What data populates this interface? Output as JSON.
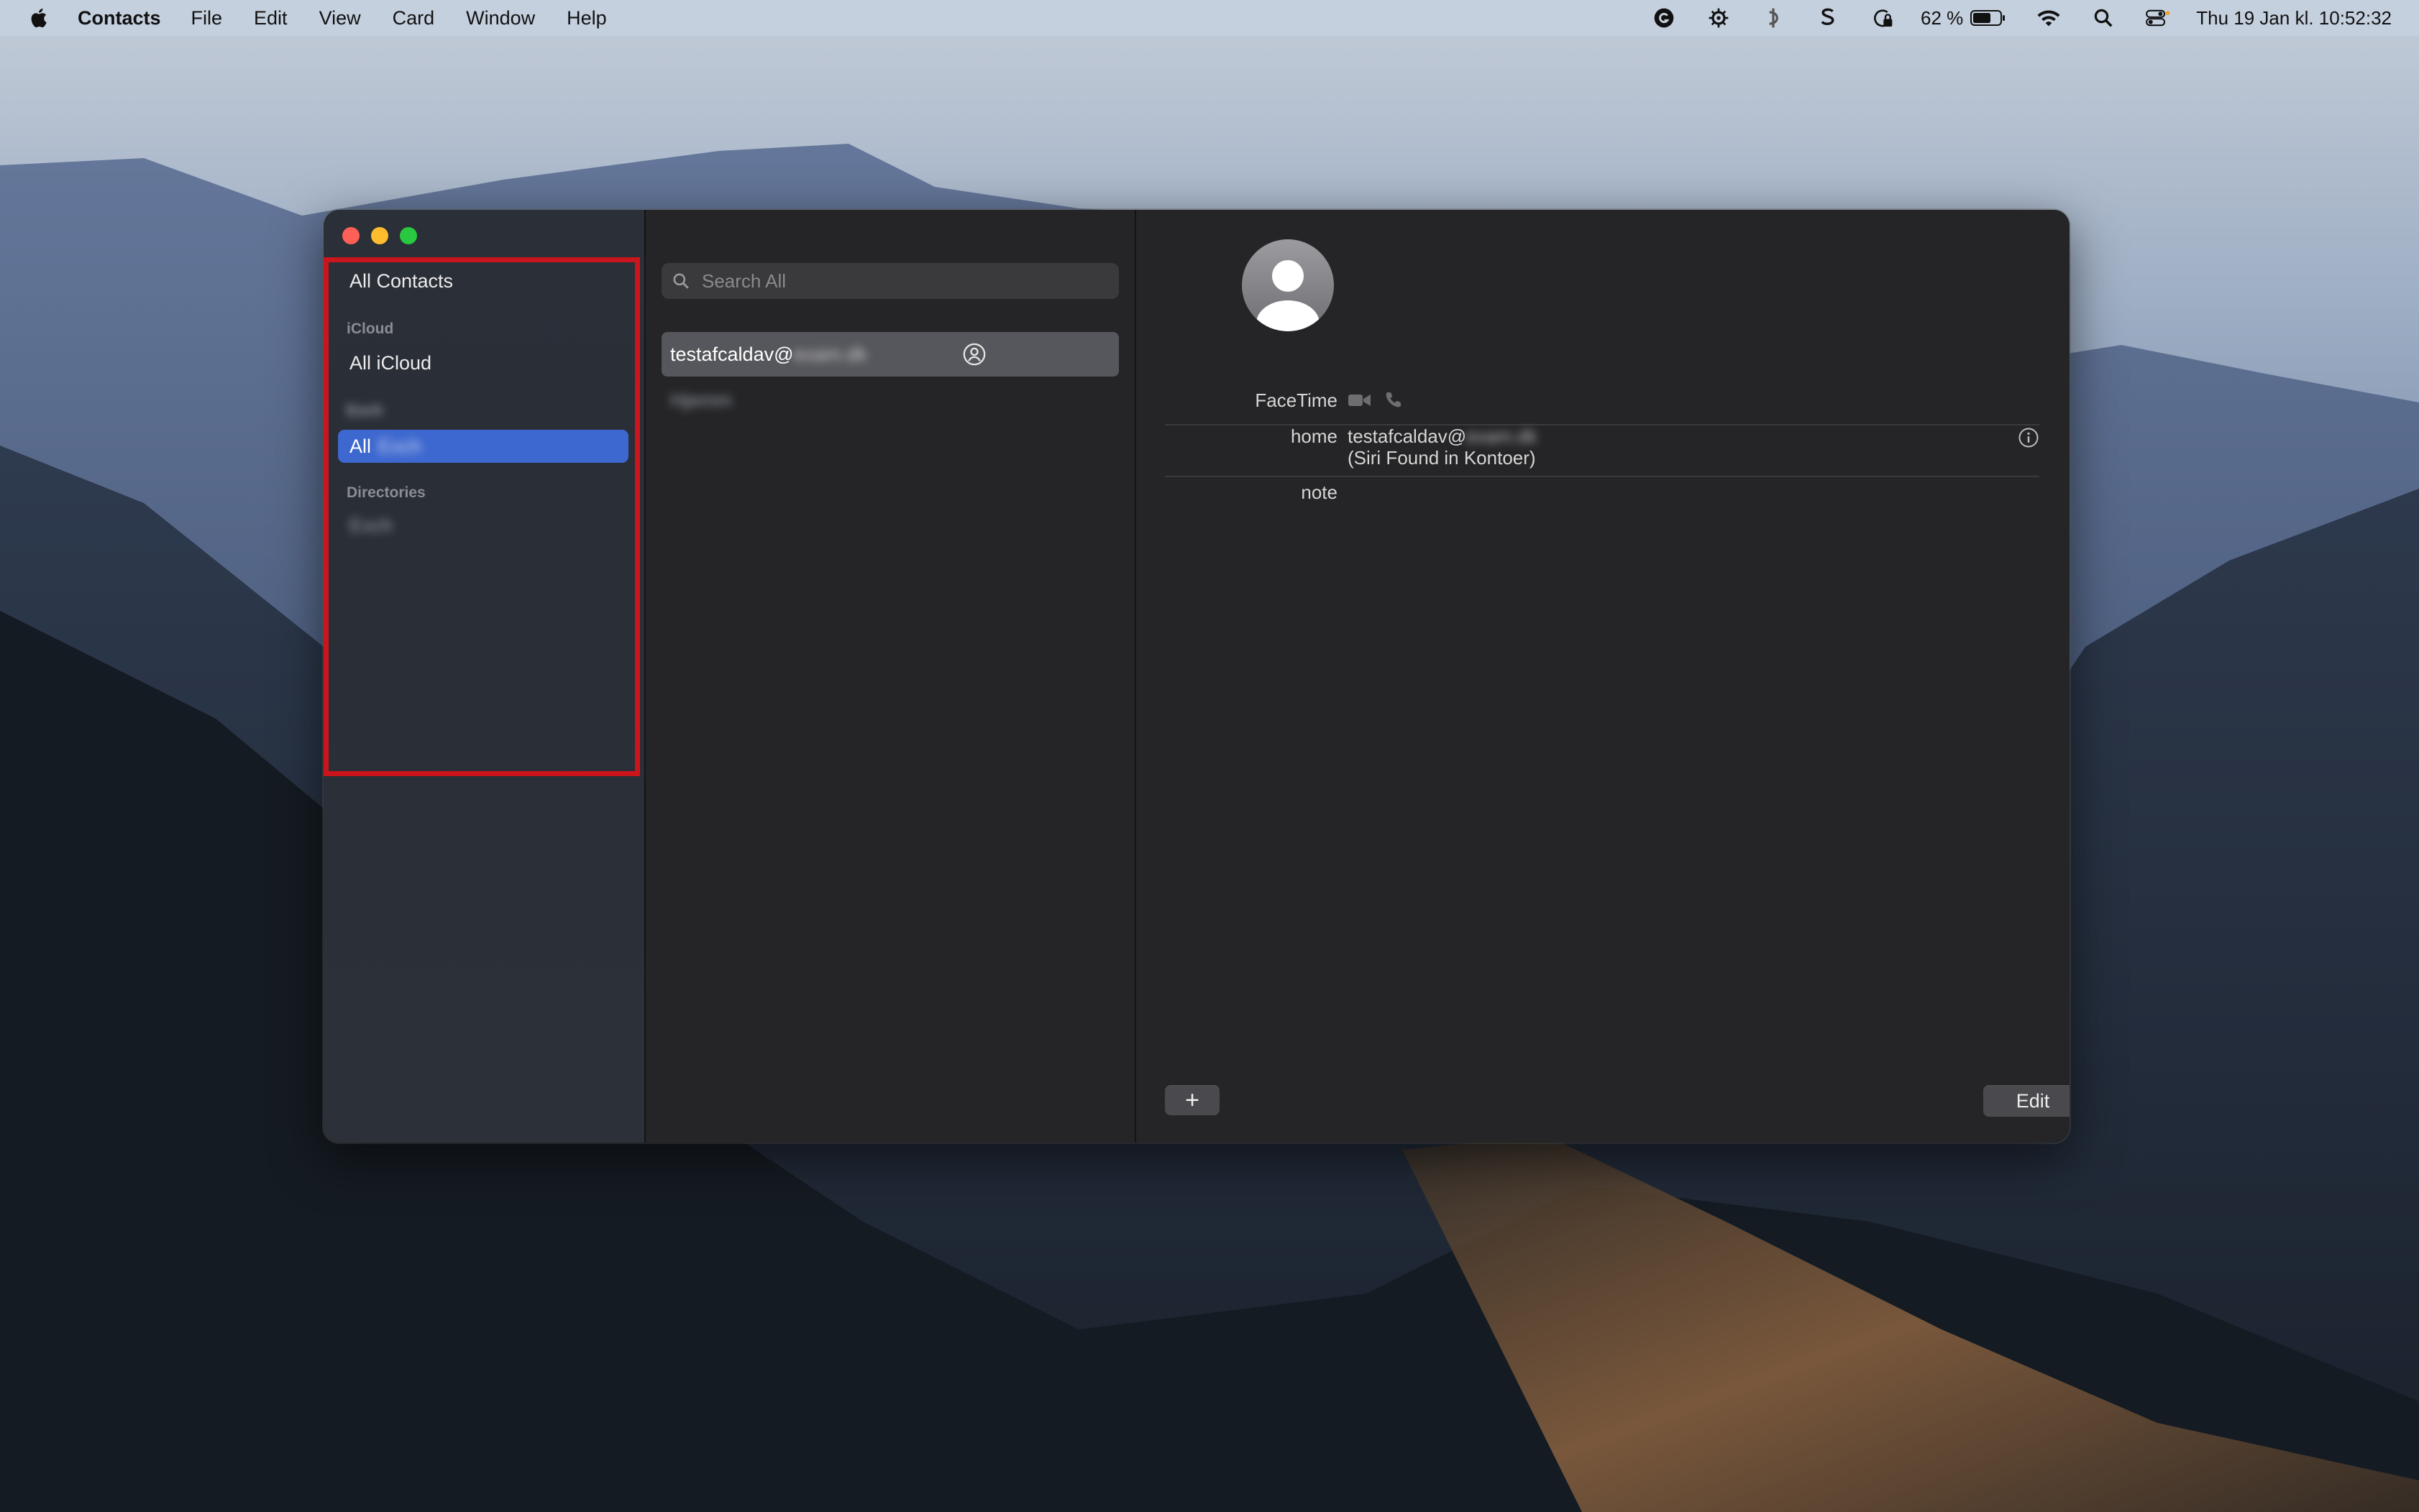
{
  "menubar": {
    "app_name": "Contacts",
    "menus": [
      "File",
      "Edit",
      "View",
      "Card",
      "Window",
      "Help"
    ],
    "battery_percent": "62 %",
    "clock": "Thu 19 Jan kl. 10:52:32",
    "icons": [
      "grammarly-icon",
      "steelseries-icon",
      "cleanup-icon",
      "scrivener-icon",
      "vpn-lock-icon",
      "battery-icon",
      "wifi-icon",
      "spotlight-search-icon",
      "control-center-icon"
    ]
  },
  "sidebar": {
    "all_contacts": "All Contacts",
    "icloud_header": "iCloud",
    "all_icloud": "All iCloud",
    "group_header_blurred": "Exch",
    "selected_item_prefix": "All",
    "selected_item_blurred": "Exch",
    "directories_header": "Directories",
    "directory_item_blurred": "Exch"
  },
  "list": {
    "search_placeholder": "Search All",
    "selected_contact_prefix": "testafcaldav@",
    "selected_contact_blurred": "exam.dk",
    "second_contact_blurred": "Hjemm"
  },
  "detail": {
    "facetime_label": "FaceTime",
    "home_label": "home",
    "home_value_prefix": "testafcaldav@",
    "home_value_blurred": "exam.dk",
    "siri_note": "(Siri Found in Kontoer)",
    "note_label": "note",
    "add_button": "+",
    "edit_button": "Edit"
  },
  "colors": {
    "selection_blue": "#3d68cf",
    "highlight_red": "#c9151b",
    "window_bg": "#252527"
  }
}
